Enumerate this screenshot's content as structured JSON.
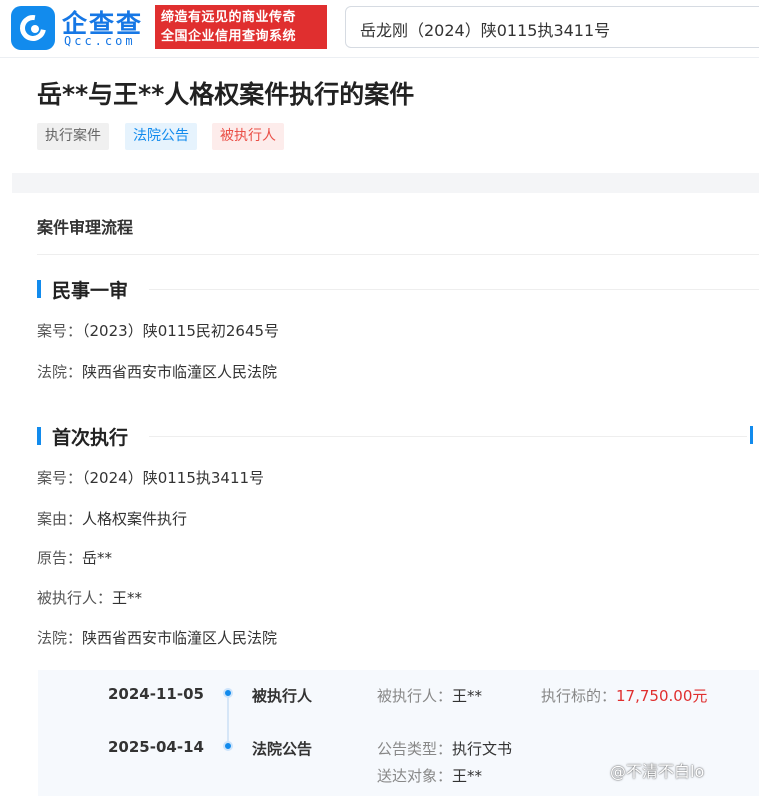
{
  "header": {
    "logo_name": "企查查",
    "logo_domain": "Qcc.com",
    "slogan_line1": "缔造有远见的商业传奇",
    "slogan_line2": "全国企业信用查询系统",
    "search_value": "岳龙刚（2024）陕0115执3411号"
  },
  "case": {
    "title": "岳**与王**人格权案件执行的案件",
    "tags": [
      "执行案件",
      "法院公告",
      "被执行人"
    ]
  },
  "process": {
    "section_title": "案件审理流程",
    "stages": [
      {
        "name": "民事一审",
        "fields": [
          {
            "key": "案号：",
            "value": "（2023）陕0115民初2645号"
          },
          {
            "key": "法院：",
            "value": "陕西省西安市临潼区人民法院"
          }
        ]
      },
      {
        "name": "首次执行",
        "fields": [
          {
            "key": "案号：",
            "value": "（2024）陕0115执3411号"
          },
          {
            "key": "案由：",
            "value": "人格权案件执行"
          },
          {
            "key": "原告：",
            "value": "岳**"
          },
          {
            "key": "被执行人：",
            "value": "王**"
          },
          {
            "key": "法院：",
            "value": "陕西省西安市临潼区人民法院"
          }
        ]
      }
    ],
    "timeline": [
      {
        "date": "2024-11-05",
        "type": "被执行人",
        "info1_key": "被执行人：",
        "info1_value": "王**",
        "info2_key": "执行标的：",
        "info2_value": "17,750.00元"
      },
      {
        "date": "2025-04-14",
        "type": "法院公告",
        "info1_key": "公告类型：",
        "info1_value": "执行文书",
        "info2_key": "送达对象：",
        "info2_value": "王**"
      }
    ]
  },
  "watermark": "@不清不白lo",
  "colors": {
    "brand_blue": "#128bed",
    "slogan_red": "#e02f2f",
    "money_red": "#e02f2f"
  }
}
